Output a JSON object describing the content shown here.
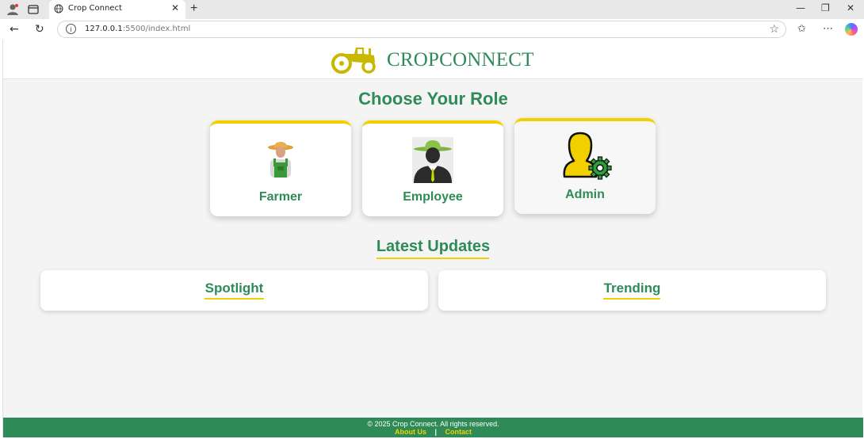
{
  "browser": {
    "tab_title": "Crop Connect",
    "url_host": "127.0.0.1",
    "url_path": ":5500/index.html",
    "icons": [
      "profile-icon",
      "tab-actions-icon",
      "globe-icon",
      "close-icon",
      "new-tab-icon",
      "minimize-icon",
      "restore-icon",
      "window-close-icon",
      "back-icon",
      "reload-icon",
      "info-icon",
      "star-icon",
      "favorites-icon",
      "more-icon",
      "copilot-icon"
    ]
  },
  "header": {
    "brand": "CROPCONNECT",
    "logo_icon": "tractor-icon"
  },
  "roles": {
    "title": "Choose Your Role",
    "items": [
      {
        "label": "Farmer",
        "icon": "farmer-icon"
      },
      {
        "label": "Employee",
        "icon": "employee-icon"
      },
      {
        "label": "Admin",
        "icon": "admin-icon"
      }
    ]
  },
  "updates": {
    "title": "Latest Updates",
    "cards": [
      {
        "label": "Spotlight"
      },
      {
        "label": "Trending"
      }
    ]
  },
  "footer": {
    "copyright": "© 2025 Crop Connect. All rights reserved.",
    "about_label": "About Us",
    "separator": "|",
    "contact_label": "Contact"
  },
  "colors": {
    "primary_green": "#2e8b57",
    "accent_yellow": "#f2d000",
    "page_background": "#f4f4f4"
  }
}
